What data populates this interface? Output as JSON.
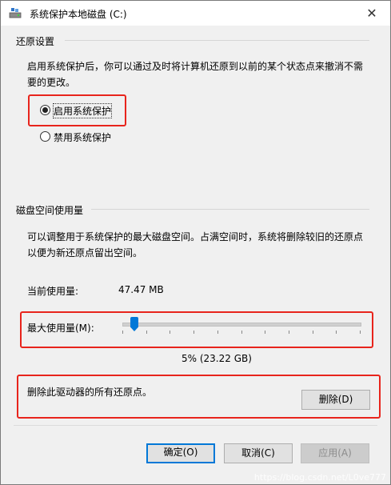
{
  "window": {
    "title": "系统保护本地磁盘 (C:)",
    "close_glyph": "✕"
  },
  "restore": {
    "heading": "还原设置",
    "desc_line1": "启用系统保护后，你可以通过及时将计算机还原到以前的某个状态点来撤消不需",
    "desc_line2": "要的更改。",
    "option_enable": "启用系统保护",
    "option_disable": "禁用系统保护",
    "selected": "enable"
  },
  "disk": {
    "heading": "磁盘空间使用量",
    "desc_line1": "可以调整用于系统保护的最大磁盘空间。占满空间时，系统将删除较旧的还原点",
    "desc_line2": "以便为新还原点留出空间。",
    "current_label": "当前使用量:",
    "current_value": "47.47 MB",
    "max_label": "最大使用量(M):",
    "slider_value_percent": 5,
    "max_value": "5% (23.22 GB)",
    "delete_desc": "删除此驱动器的所有还原点。",
    "delete_button": "删除(D)"
  },
  "buttons": {
    "ok": "确定(O)",
    "cancel": "取消(C)",
    "apply": "应用(A)"
  },
  "watermark": "https://blog.csdn.net/L0ve777",
  "colors": {
    "accent": "#0078d7",
    "highlight_box": "#e8241c"
  },
  "icons": {
    "title": "drive-shield-icon",
    "close": "close-icon"
  }
}
